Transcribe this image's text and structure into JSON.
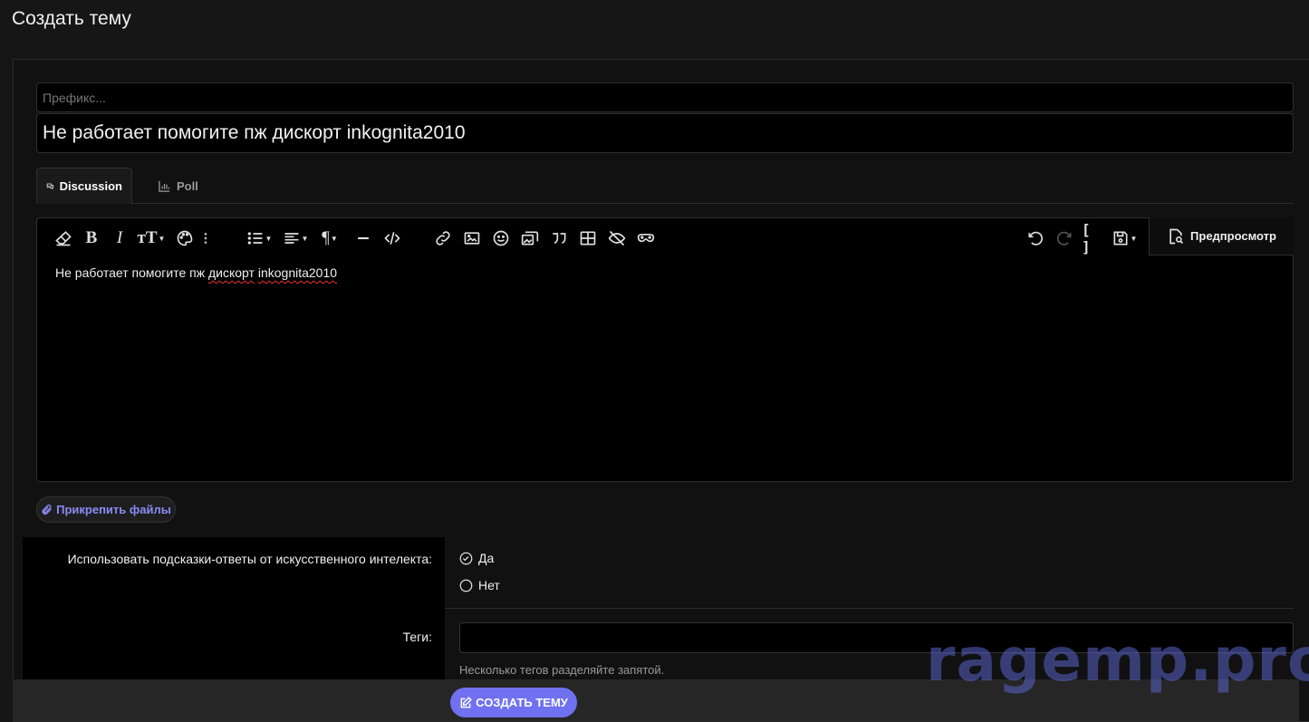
{
  "page": {
    "title": "Создать тему"
  },
  "form": {
    "prefix_placeholder": "Префикс...",
    "title_value": "Не работает помогите пж дискорт inkognita2010"
  },
  "tabs": [
    {
      "label": "Discussion",
      "icon": "comments-icon",
      "active": true
    },
    {
      "label": "Poll",
      "icon": "bar-chart-icon",
      "active": false
    }
  ],
  "editor": {
    "preview_label": "Предпросмотр",
    "content_plain": "Не работает помогите пж ",
    "content_misspelled_1": "дискорт",
    "content_space": " ",
    "content_misspelled_2": "inkognita2010",
    "toolbar_left": [
      "eraser-icon",
      "bold-icon",
      "italic-icon",
      "text-size-icon",
      "palette-icon",
      "more-vertical-icon",
      "list-icon",
      "align-icon",
      "paragraph-icon",
      "horizontal-line-icon",
      "code-icon",
      "link-icon",
      "image-icon",
      "smile-icon",
      "media-icon",
      "quote-icon",
      "table-icon",
      "spoiler-icon",
      "inline-spoiler-icon"
    ],
    "toolbar_right": [
      "undo-icon",
      "redo-icon",
      "bbcode-toggle-icon",
      "drafts-icon"
    ]
  },
  "attach": {
    "label": "Прикрепить файлы"
  },
  "ai_hints": {
    "label": "Использовать подсказки-ответы от искусственного интелекта:",
    "options": [
      {
        "label": "Да",
        "checked": true
      },
      {
        "label": "Нет",
        "checked": false
      }
    ]
  },
  "tags": {
    "label": "Теги:",
    "value": "",
    "hint": "Несколько тегов разделяйте запятой."
  },
  "submit": {
    "label": "СОЗДАТЬ ТЕМУ"
  },
  "watermark": {
    "text": "ragemp.pro"
  },
  "colors": {
    "accent": "#6f71f0",
    "link": "#8a8bf5",
    "background": "#161616"
  }
}
